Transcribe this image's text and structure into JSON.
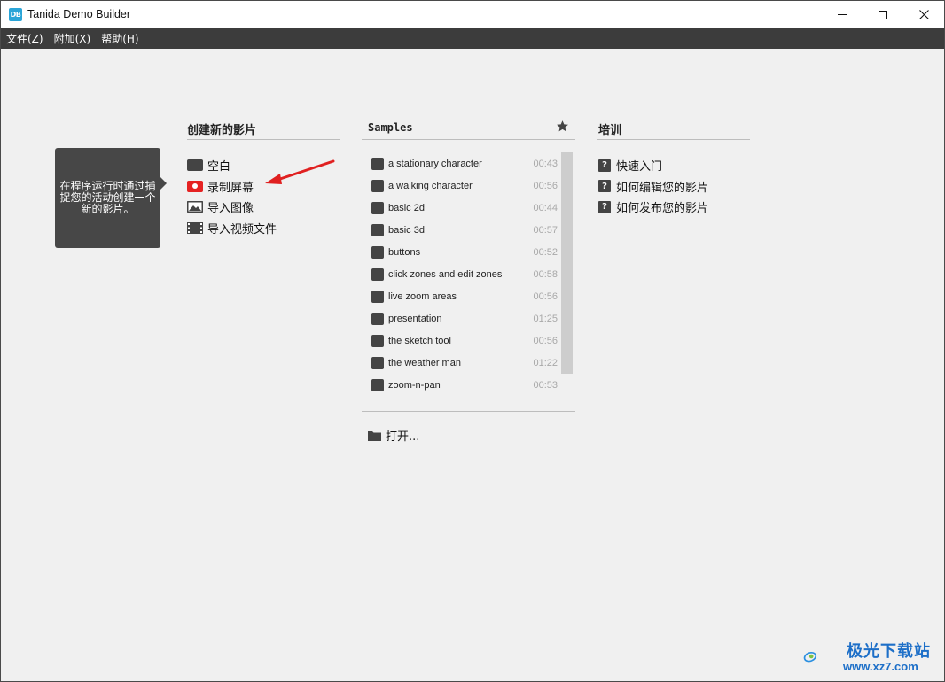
{
  "window": {
    "icon_text": "DB",
    "title": "Tanida Demo Builder"
  },
  "menu": {
    "items": [
      {
        "label": "文件(Z)"
      },
      {
        "label": "附加(X)"
      },
      {
        "label": "帮助(H)"
      }
    ]
  },
  "tooltip": {
    "text": "在程序运行时通过捕捉您的活动创建一个新的影片。"
  },
  "create": {
    "header": "创建新的影片",
    "items": [
      {
        "label": "空白",
        "icon": "blank-icon"
      },
      {
        "label": "录制屏幕",
        "icon": "record-icon"
      },
      {
        "label": "导入图像",
        "icon": "image-icon"
      },
      {
        "label": "导入视频文件",
        "icon": "film-icon"
      }
    ]
  },
  "samples": {
    "header": "Samples",
    "items": [
      {
        "name": "a stationary character",
        "duration": "00:43"
      },
      {
        "name": "a walking character",
        "duration": "00:56"
      },
      {
        "name": "basic 2d",
        "duration": "00:44"
      },
      {
        "name": "basic 3d",
        "duration": "00:57"
      },
      {
        "name": "buttons",
        "duration": "00:52"
      },
      {
        "name": "click zones and edit zones",
        "duration": "00:58"
      },
      {
        "name": "live zoom areas",
        "duration": "00:56"
      },
      {
        "name": "presentation",
        "duration": "01:25"
      },
      {
        "name": "the sketch tool",
        "duration": "00:56"
      },
      {
        "name": "the weather man",
        "duration": "01:22"
      },
      {
        "name": "zoom-n-pan",
        "duration": "00:53"
      }
    ],
    "open_label": "打开..."
  },
  "training": {
    "header": "培训",
    "items": [
      {
        "label": "快速入门"
      },
      {
        "label": "如何编辑您的影片"
      },
      {
        "label": "如何发布您的影片"
      }
    ]
  },
  "watermark": {
    "brand": "极光下载站",
    "url": "www.xz7.com"
  },
  "colors": {
    "menubar": "#3c3c3c",
    "record_red": "#e52222",
    "arrow_red": "#e02020",
    "tooltip_bg": "#474747"
  }
}
